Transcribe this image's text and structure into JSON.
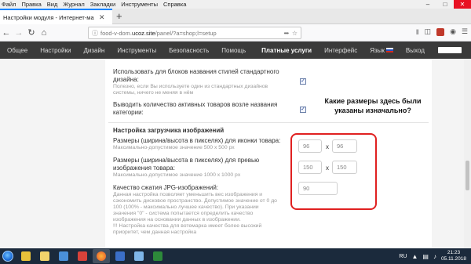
{
  "menu": {
    "items": [
      "Файл",
      "Правка",
      "Вид",
      "Журнал",
      "Закладки",
      "Инструменты",
      "Справка"
    ]
  },
  "window_controls": [
    "minimize-icon",
    "maximize-icon",
    "close-icon"
  ],
  "tab": {
    "title": "Настройки модуля - Интернет-ма"
  },
  "urlbar": {
    "prefix": "food-v-dom.",
    "domain": "ucoz.site",
    "path": "/panel/?a=shop;l=setup"
  },
  "site_nav": {
    "items": [
      "Общее",
      "Настройки",
      "Дизайн",
      "Инструменты",
      "Безопасность",
      "Помощь"
    ],
    "paid": "Платные услуги",
    "interface": "Интерфейс",
    "lang": "Язык",
    "logout": "Выход"
  },
  "settings": {
    "row1": {
      "label_line1": "Использовать для блоков названия стилей стандартного",
      "label_line2": "дизайна:",
      "hint_line1": "Полезно, если Вы используете один из стандартных дизайнов",
      "hint_line2": "системы, ничего не меняя в нём",
      "checked": true
    },
    "row2": {
      "label_line1": "Выводить количество активных товаров возле названия",
      "label_line2": "категории:",
      "checked": true
    },
    "section_title": "Настройка загрузчика изображений",
    "icon_size": {
      "label": "Размеры (ширина/высота в пикселях) для иконки товара:",
      "hint": "Максимально-допустимое значение 500 х 500 px",
      "width": "96",
      "height": "96"
    },
    "preview_size": {
      "label_line1": "Размеры (ширина/высота в пикселях) для превью",
      "label_line2": "изображения товара:",
      "hint": "Максимально-допустимое значение 1000 х 1000 px",
      "width": "150",
      "height": "150"
    },
    "jpg_quality": {
      "label": "Качество сжатия JPG-изображений:",
      "hint_lines": [
        "Данная настройка позволяет уменьшить вес изображения и",
        "сэкономить дисковое пространство. Допустимое значение от 0 до",
        "100 (100% - максимально лучшее качество). При указании",
        "значения \"0\" - система попытается определить качество",
        "изображения на основании данных в изображении.",
        "!!! Настройка качества для вотемарка имеет более высокий",
        "приоритет, чем данная настройка"
      ],
      "value": "90"
    },
    "separator": "x"
  },
  "annotation": {
    "line1": "Какие размеры здесь были",
    "line2": "указаны изначально?"
  },
  "taskbar": {
    "lang": "RU",
    "time": "21:23",
    "date": "05.11.2018"
  },
  "colors": {
    "site_nav_bg": "#3a3a3a",
    "highlight_border": "#e02020",
    "taskbar_bg": "#1b2a3c",
    "tab_accent": "#0a84ff"
  }
}
